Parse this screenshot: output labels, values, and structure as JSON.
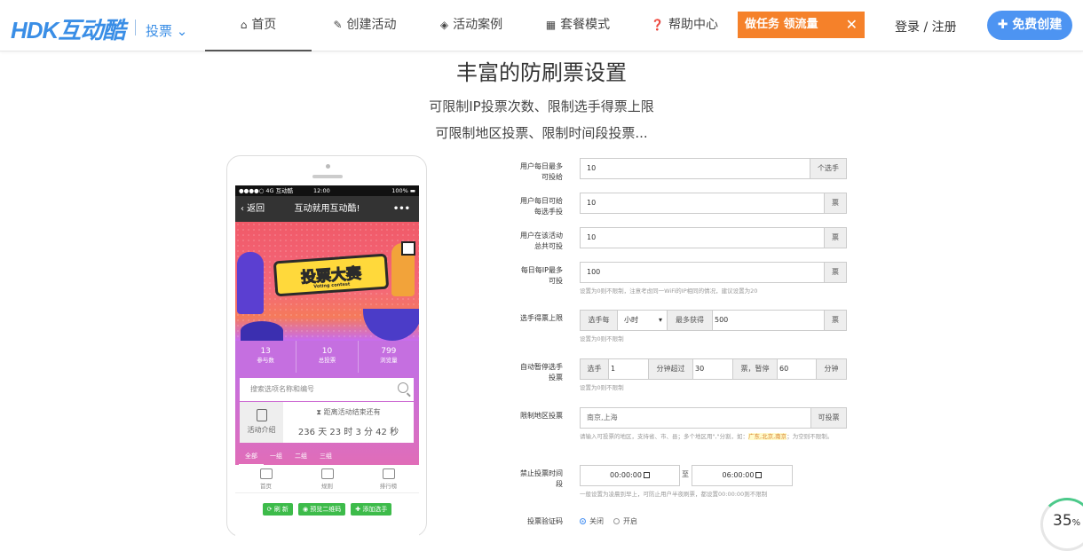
{
  "nav": {
    "logo": "HDK互动酷",
    "logo_sub": "投票 ⌄",
    "items": [
      {
        "label": "首页",
        "icon": "home-icon",
        "glyph": "⌂"
      },
      {
        "label": "创建活动",
        "icon": "edit-icon",
        "glyph": "✎"
      },
      {
        "label": "活动案例",
        "icon": "cube-icon",
        "glyph": "◈"
      },
      {
        "label": "套餐模式",
        "icon": "grid-icon",
        "glyph": "▦"
      },
      {
        "label": "帮助中心",
        "icon": "question-icon",
        "glyph": "❓"
      }
    ],
    "task_label": "做任务 领流量",
    "task_close": "✕",
    "login_label": "登录 / 注册",
    "free_label": "✚ 免费创建"
  },
  "hero": {
    "title": "丰富的防刷票设置",
    "line1": "可限制IP投票次数、限制选手得票上限",
    "line2": "可限制地区投票、限制时间段投票..."
  },
  "phone": {
    "status_left": "●●●●○ 4G 互动酷",
    "status_time": "12:00",
    "status_right": "100% ▬",
    "back": "‹ 返回",
    "title": "互动就用互动酷!",
    "more": "•••",
    "banner_title": "投票大赛",
    "banner_sub": "Voting contest",
    "stats": [
      {
        "value": "13",
        "label": "参与数"
      },
      {
        "value": "10",
        "label": "总投票"
      },
      {
        "value": "799",
        "label": "浏览量"
      }
    ],
    "search_placeholder": "搜索选项名称和编号",
    "intro_label": "活动介绍",
    "countdown_label": "⧗ 距离活动结束还有",
    "countdown_value": "236 天 23 时 3 分 42 秒",
    "tabs": [
      "全部",
      "一组",
      "二组",
      "三组"
    ],
    "bottom_nav": [
      "首页",
      "规则",
      "排行榜"
    ],
    "actions": [
      "⟳ 刷 新",
      "◉ 预览二维码",
      "✚ 添加选手"
    ]
  },
  "form": {
    "daily_votes": {
      "label": "用户每日最多可投给",
      "value": "10",
      "unit": "个选手"
    },
    "daily_per_player": {
      "label": "用户每日可给每选手投",
      "value": "10",
      "unit": "票"
    },
    "total_votes": {
      "label": "用户在该活动总共可投",
      "value": "10",
      "unit": "票"
    },
    "ip_limit": {
      "label": "每日每IP最多可投",
      "value": "100",
      "unit": "票",
      "hint": "设置为0则不限制，注意考虑同一WiFi的IP相同的情况，建议设置为20"
    },
    "player_cap": {
      "label": "选手得票上限",
      "prefix": "选手每",
      "period": "小时",
      "caret": "▾",
      "mid": "最多获得",
      "value": "500",
      "unit": "票",
      "hint": "设置为0则不限制"
    },
    "auto_pause": {
      "label": "自动暂停选手投票",
      "prefix": "选手",
      "value1": "1",
      "mid": "分钟超过",
      "value2": "30",
      "mid2": "票，暂停",
      "value3": "60",
      "unit": "分钟",
      "hint": "设置为0则不限制"
    },
    "region": {
      "label": "限制地区投票",
      "value": "南京,上海",
      "unit": "可投票",
      "hint_pre": "请输入可投票的地区，支持省、市、县；多个地区用\",\"分割，如：",
      "hint_hl": "广东,北京,南京",
      "hint_post": "；为空则不限制。"
    },
    "time_ban": {
      "label": "禁止投票时间段",
      "from": "00:00:00",
      "sep": "至",
      "to": "06:00:00",
      "hint": "一般设置为凌晨到早上，可防止用户半夜刷票，都设置00:00:00则不限制"
    },
    "captcha": {
      "label": "投票验证码",
      "opt_off": "关闭",
      "opt_on": "开启"
    }
  },
  "progress": {
    "value": "35",
    "unit": "%"
  }
}
